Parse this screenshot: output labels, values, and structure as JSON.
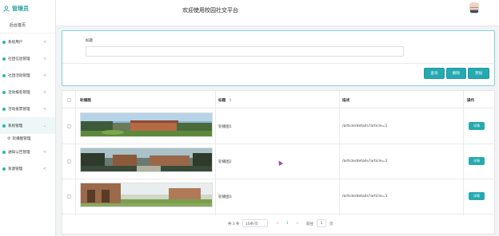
{
  "sidebar": {
    "brand": "管理员",
    "home": "后台首页",
    "items": [
      {
        "label": "系统用户",
        "chevron": "<"
      },
      {
        "label": "社团信息管理",
        "chevron": "<"
      },
      {
        "label": "社团活动管理",
        "chevron": "<"
      },
      {
        "label": "活动报名管理",
        "chevron": "<"
      },
      {
        "label": "活动投票管理",
        "chevron": "<"
      },
      {
        "label": "系统管理",
        "chevron": "⌄"
      },
      {
        "label": "通知公告管理",
        "chevron": "<"
      },
      {
        "label": "资源管理",
        "chevron": "<"
      }
    ],
    "submenu": {
      "label": "轮播图管理",
      "icon": "gear-icon"
    }
  },
  "topbar": {
    "welcome": "欢迎使用校园社交平台",
    "avatar_icon": "avatar-icon"
  },
  "search": {
    "title_label": "标题",
    "title_value": "",
    "buttons": {
      "query": "查询",
      "delete": "删除",
      "add": "添加"
    }
  },
  "table": {
    "headers": {
      "image": "轮播图",
      "title": "标题",
      "sort_icon": "⇕",
      "desc": "描述",
      "action": "操作"
    },
    "rows": [
      {
        "title": "轮播图1",
        "desc": "/article/details?article=1",
        "action": "详情"
      },
      {
        "title": "轮播图2",
        "desc": "/article/details?article=2",
        "action": "详情"
      },
      {
        "title": "轮播图3",
        "desc": "/article/details?article=3",
        "action": "详情"
      }
    ]
  },
  "pagination": {
    "total": "共 3 条",
    "page_size": "10条/页",
    "prev": "<",
    "current_page": "1",
    "next": ">",
    "goto_label": "前往",
    "goto_value": "1",
    "page_unit": "页"
  },
  "colors": {
    "accent": "#26a9b0",
    "brand": "#20a0a0"
  }
}
